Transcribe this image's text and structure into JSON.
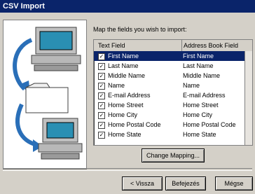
{
  "window": {
    "title": "CSV Import"
  },
  "instructions": "Map the fields you wish to import:",
  "grid": {
    "headers": [
      "Text Field",
      "Address Book Field"
    ],
    "rows": [
      [
        "First Name",
        "First Name"
      ],
      [
        "Last Name",
        "Last Name"
      ],
      [
        "Middle Name",
        "Middle Name"
      ],
      [
        "Name",
        "Name"
      ],
      [
        "E-mail Address",
        "E-mail Address"
      ],
      [
        "Home Street",
        "Home Street"
      ],
      [
        "Home City",
        "Home City"
      ],
      [
        "Home Postal Code",
        "Home Postal Code"
      ],
      [
        "Home State",
        "Home State"
      ]
    ],
    "checked": [
      true,
      true,
      true,
      true,
      true,
      true,
      true,
      true,
      true
    ]
  },
  "buttons": {
    "change_mapping": "Change Mapping...",
    "back": "< Vissza",
    "next": "Befejezés",
    "cancel": "Mégse"
  },
  "colors": {
    "selection": "#0a246a",
    "face": "#d4d0c8"
  }
}
